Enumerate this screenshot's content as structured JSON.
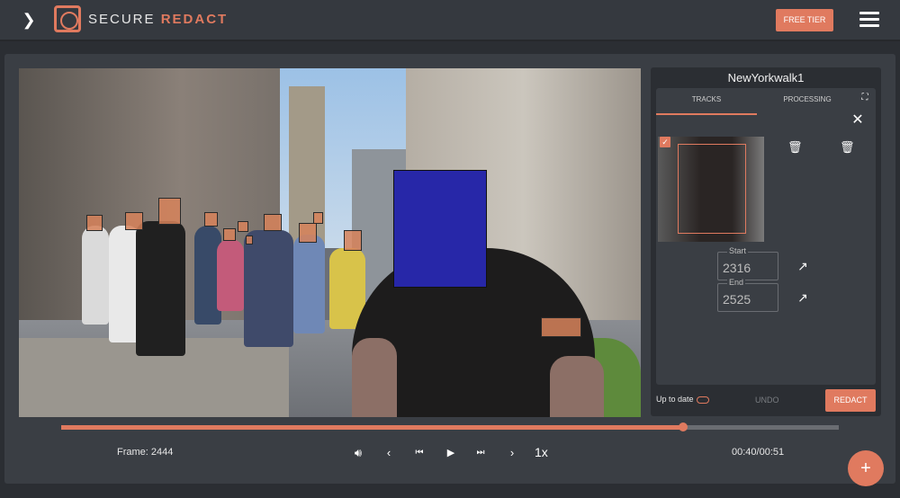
{
  "brand": {
    "name_light": "SECURE",
    "name_bold": "REDACT"
  },
  "header": {
    "tier_label": "FREE TIER"
  },
  "player": {
    "frame_label": "Frame: 2444",
    "speed": "1x",
    "time": "00:40/00:51",
    "progress": 0.8
  },
  "side": {
    "title": "NewYorkwalk1",
    "tabs": [
      "TRACKS",
      "PROCESSING"
    ],
    "start_label": "Start",
    "start_value": "2316",
    "end_label": "End",
    "end_value": "2525",
    "status": "Up to date",
    "undo_label": "UNDO",
    "redact_label": "REDACT"
  },
  "colors": {
    "accent": "#e07a5f",
    "background": "#2b2e33",
    "panel": "#3a3e44"
  },
  "icons": [
    "chevron-right-icon",
    "hamburger-icon",
    "volume-icon",
    "prev-icon",
    "skip-back-icon",
    "play-icon",
    "skip-forward-icon",
    "next-icon",
    "fullscreen-icon",
    "close-icon",
    "trash-icon",
    "trash-list-icon",
    "jump-icon",
    "cloud-icon",
    "plus-icon"
  ]
}
